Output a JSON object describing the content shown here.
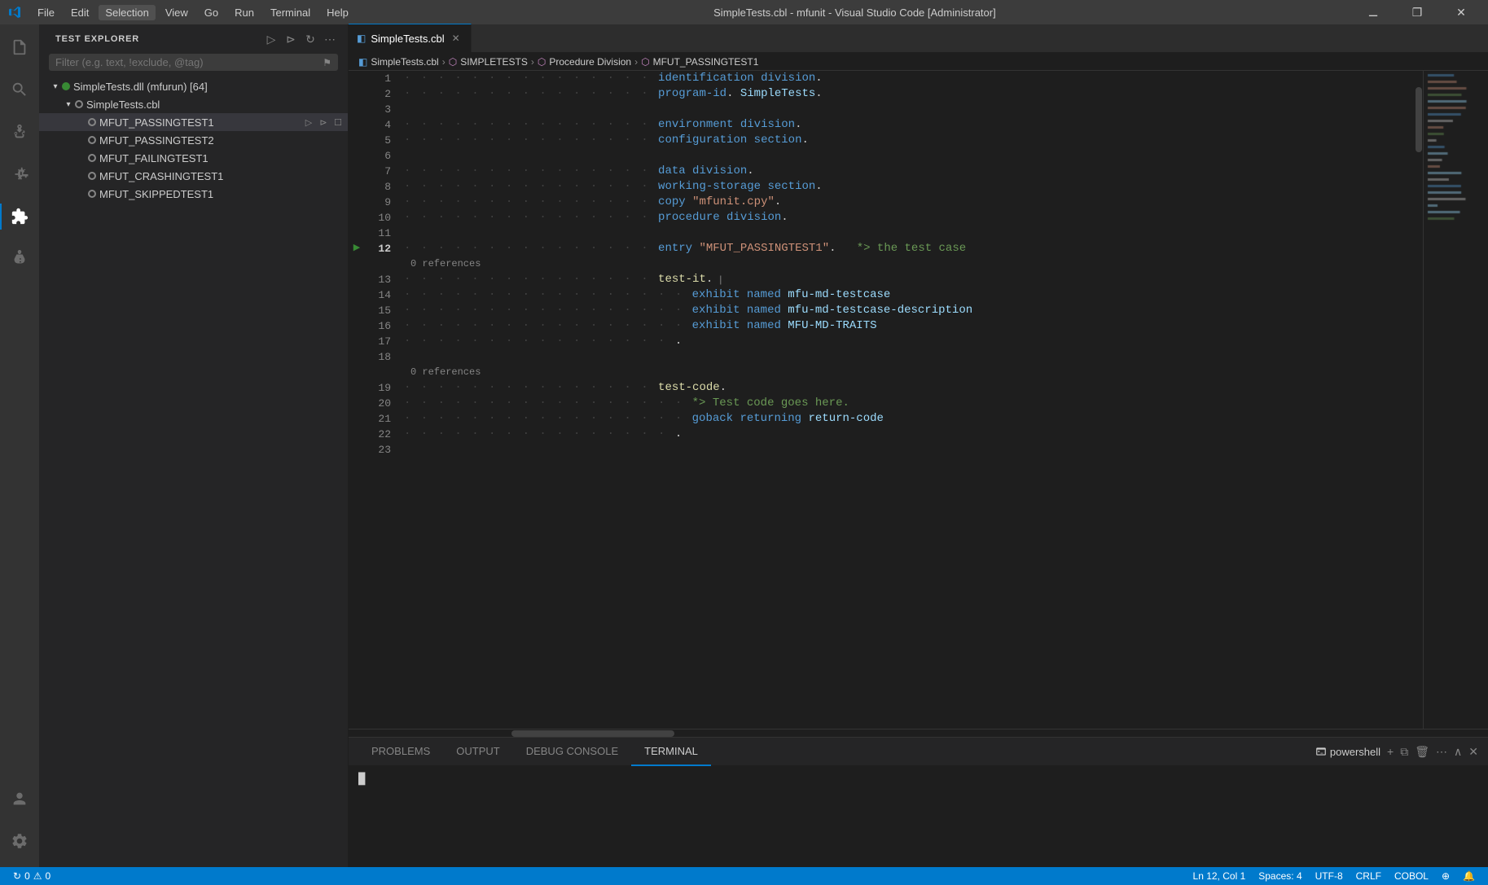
{
  "titlebar": {
    "app_title": "SimpleTests.cbl - mfunit - Visual Studio Code [Administrator]",
    "menu": [
      "File",
      "Edit",
      "Selection",
      "View",
      "Go",
      "Run",
      "Terminal",
      "Help"
    ],
    "window_controls": [
      "minimize",
      "maximize",
      "close"
    ]
  },
  "activity_bar": {
    "icons": [
      "explorer",
      "search",
      "source-control",
      "run",
      "extensions",
      "test",
      "account",
      "settings"
    ]
  },
  "sidebar": {
    "title": "TEST EXPLORER",
    "filter_placeholder": "Filter (e.g. text, !exclude, @tag)",
    "tree": [
      {
        "label": "SimpleTests.dll (mfurun) [64]",
        "level": 1,
        "expanded": true,
        "type": "dll"
      },
      {
        "label": "SimpleTests.cbl",
        "level": 2,
        "expanded": true,
        "type": "file"
      },
      {
        "label": "MFUT_PASSINGTEST1",
        "level": 3,
        "expanded": false,
        "type": "test",
        "selected": true
      },
      {
        "label": "MFUT_PASSINGTEST2",
        "level": 3,
        "expanded": false,
        "type": "test"
      },
      {
        "label": "MFUT_FAILINGTEST1",
        "level": 3,
        "expanded": false,
        "type": "test"
      },
      {
        "label": "MFUT_CRASHINGTEST1",
        "level": 3,
        "expanded": false,
        "type": "test"
      },
      {
        "label": "MFUT_SKIPPEDTEST1",
        "level": 3,
        "expanded": false,
        "type": "test"
      }
    ]
  },
  "editor": {
    "tab_label": "SimpleTests.cbl",
    "breadcrumb": [
      "SimpleTests.cbl",
      "SIMPLETESTS",
      "Procedure Division",
      "MFUT_PASSINGTEST1"
    ],
    "lines": [
      {
        "num": 1,
        "content": "identification division.",
        "tokens": [
          {
            "t": "identification division",
            "c": "kw"
          },
          {
            "t": ".",
            "c": "dot"
          }
        ]
      },
      {
        "num": 2,
        "content": "program-id. SimpleTests.",
        "tokens": [
          {
            "t": "program-id",
            "c": "kw"
          },
          {
            "t": ". ",
            "c": "dot"
          },
          {
            "t": "SimpleTests",
            "c": "plain"
          },
          {
            "t": ".",
            "c": "dot"
          }
        ]
      },
      {
        "num": 3,
        "content": ""
      },
      {
        "num": 4,
        "content": "environment division.",
        "tokens": [
          {
            "t": "environment division",
            "c": "kw"
          },
          {
            "t": ".",
            "c": "dot"
          }
        ]
      },
      {
        "num": 5,
        "content": "configuration section.",
        "tokens": [
          {
            "t": "configuration section",
            "c": "kw"
          },
          {
            "t": ".",
            "c": "dot"
          }
        ]
      },
      {
        "num": 6,
        "content": ""
      },
      {
        "num": 7,
        "content": "data division.",
        "tokens": [
          {
            "t": "data division",
            "c": "kw"
          },
          {
            "t": ".",
            "c": "dot"
          }
        ]
      },
      {
        "num": 8,
        "content": "working-storage section.",
        "tokens": [
          {
            "t": "working-storage section",
            "c": "kw"
          },
          {
            "t": ".",
            "c": "dot"
          }
        ]
      },
      {
        "num": 9,
        "content": "copy \"mfunit.cpy\".",
        "tokens": [
          {
            "t": "copy ",
            "c": "kw"
          },
          {
            "t": "\"mfunit.cpy\"",
            "c": "str"
          },
          {
            "t": ".",
            "c": "dot"
          }
        ]
      },
      {
        "num": 10,
        "content": "procedure division.",
        "tokens": [
          {
            "t": "procedure division",
            "c": "kw"
          },
          {
            "t": ".",
            "c": "dot"
          }
        ]
      },
      {
        "num": 11,
        "content": ""
      },
      {
        "num": 12,
        "content": "entry \"MFUT_PASSINGTEST1\".   *> the test case",
        "run_arrow": true,
        "tokens": [
          {
            "t": "entry ",
            "c": "kw"
          },
          {
            "t": "\"MFUT_PASSINGTEST1\"",
            "c": "str"
          },
          {
            "t": ".   ",
            "c": "dot"
          },
          {
            "t": "*> the test case",
            "c": "comment"
          }
        ]
      },
      {
        "num": "refs1",
        "content": "0 references",
        "is_refs": true
      },
      {
        "num": 13,
        "content": "test-it.",
        "tokens": [
          {
            "t": "test-it",
            "c": "fn"
          },
          {
            "t": ".",
            "c": "dot"
          }
        ]
      },
      {
        "num": 14,
        "content": "    exhibit named mfu-md-testcase",
        "tokens": [
          {
            "t": "    exhibit named ",
            "c": "kw"
          },
          {
            "t": "mfu-md-testcase",
            "c": "plain"
          }
        ]
      },
      {
        "num": 15,
        "content": "    exhibit named mfu-md-testcase-description",
        "tokens": [
          {
            "t": "    exhibit named ",
            "c": "kw"
          },
          {
            "t": "mfu-md-testcase-description",
            "c": "plain"
          }
        ]
      },
      {
        "num": 16,
        "content": "    exhibit named MFU-MD-TRAITS",
        "tokens": [
          {
            "t": "    exhibit named ",
            "c": "kw"
          },
          {
            "t": "MFU-MD-TRAITS",
            "c": "plain"
          }
        ]
      },
      {
        "num": 17,
        "content": "    .",
        "tokens": [
          {
            "t": "    .",
            "c": "dot"
          }
        ]
      },
      {
        "num": 18,
        "content": ""
      },
      {
        "num": "refs2",
        "content": "0 references",
        "is_refs": true
      },
      {
        "num": 19,
        "content": "test-code.",
        "tokens": [
          {
            "t": "test-code",
            "c": "fn"
          },
          {
            "t": ".",
            "c": "dot"
          }
        ]
      },
      {
        "num": 20,
        "content": "    *> Test code goes here.",
        "tokens": [
          {
            "t": "    *> Test code goes here.",
            "c": "comment"
          }
        ]
      },
      {
        "num": 21,
        "content": "    goback returning return-code",
        "tokens": [
          {
            "t": "    goback returning ",
            "c": "kw"
          },
          {
            "t": "return-code",
            "c": "plain"
          }
        ]
      },
      {
        "num": 22,
        "content": "    .",
        "tokens": [
          {
            "t": "    .",
            "c": "dot"
          }
        ]
      },
      {
        "num": 23,
        "content": ""
      }
    ]
  },
  "panel": {
    "tabs": [
      "PROBLEMS",
      "OUTPUT",
      "DEBUG CONSOLE",
      "TERMINAL"
    ],
    "active_tab": "TERMINAL",
    "terminal_shell": "powershell",
    "terminal_prompt": "█"
  },
  "statusbar": {
    "left": [
      {
        "icon": "sync",
        "label": "0"
      },
      {
        "icon": "warning",
        "label": "0"
      }
    ],
    "right": [
      {
        "label": "Ln 12, Col 1"
      },
      {
        "label": "Spaces: 4"
      },
      {
        "label": "UTF-8"
      },
      {
        "label": "CRLF"
      },
      {
        "label": "COBOL"
      },
      {
        "label": "⊕"
      },
      {
        "label": "🔔"
      }
    ]
  }
}
